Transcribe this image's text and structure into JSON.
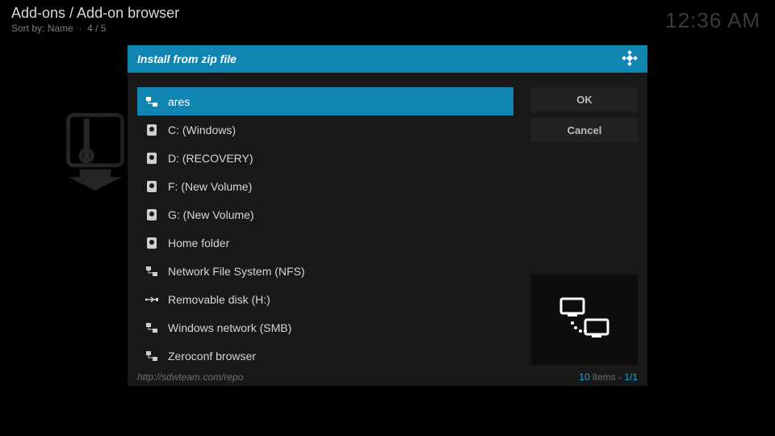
{
  "header": {
    "breadcrumb": "Add-ons / Add-on browser",
    "sort_label": "Sort by:",
    "sort_value": "Name",
    "position": "4 / 5"
  },
  "clock": "12:36 AM",
  "dialog": {
    "title": "Install from zip file",
    "items": [
      {
        "label": "ares",
        "icon": "network",
        "selected": true
      },
      {
        "label": "C: (Windows)",
        "icon": "drive",
        "selected": false
      },
      {
        "label": "D: (RECOVERY)",
        "icon": "drive",
        "selected": false
      },
      {
        "label": "F: (New Volume)",
        "icon": "drive",
        "selected": false
      },
      {
        "label": "G: (New Volume)",
        "icon": "drive",
        "selected": false
      },
      {
        "label": "Home folder",
        "icon": "drive",
        "selected": false
      },
      {
        "label": "Network File System (NFS)",
        "icon": "network",
        "selected": false
      },
      {
        "label": "Removable disk (H:)",
        "icon": "usb",
        "selected": false
      },
      {
        "label": "Windows network (SMB)",
        "icon": "network",
        "selected": false
      },
      {
        "label": "Zeroconf browser",
        "icon": "network",
        "selected": false
      }
    ],
    "buttons": {
      "ok": "OK",
      "cancel": "Cancel"
    },
    "footer": {
      "path": "http://sdwteam.com/repo",
      "count": "10",
      "count_suffix": " items - ",
      "page": "1/1"
    }
  }
}
